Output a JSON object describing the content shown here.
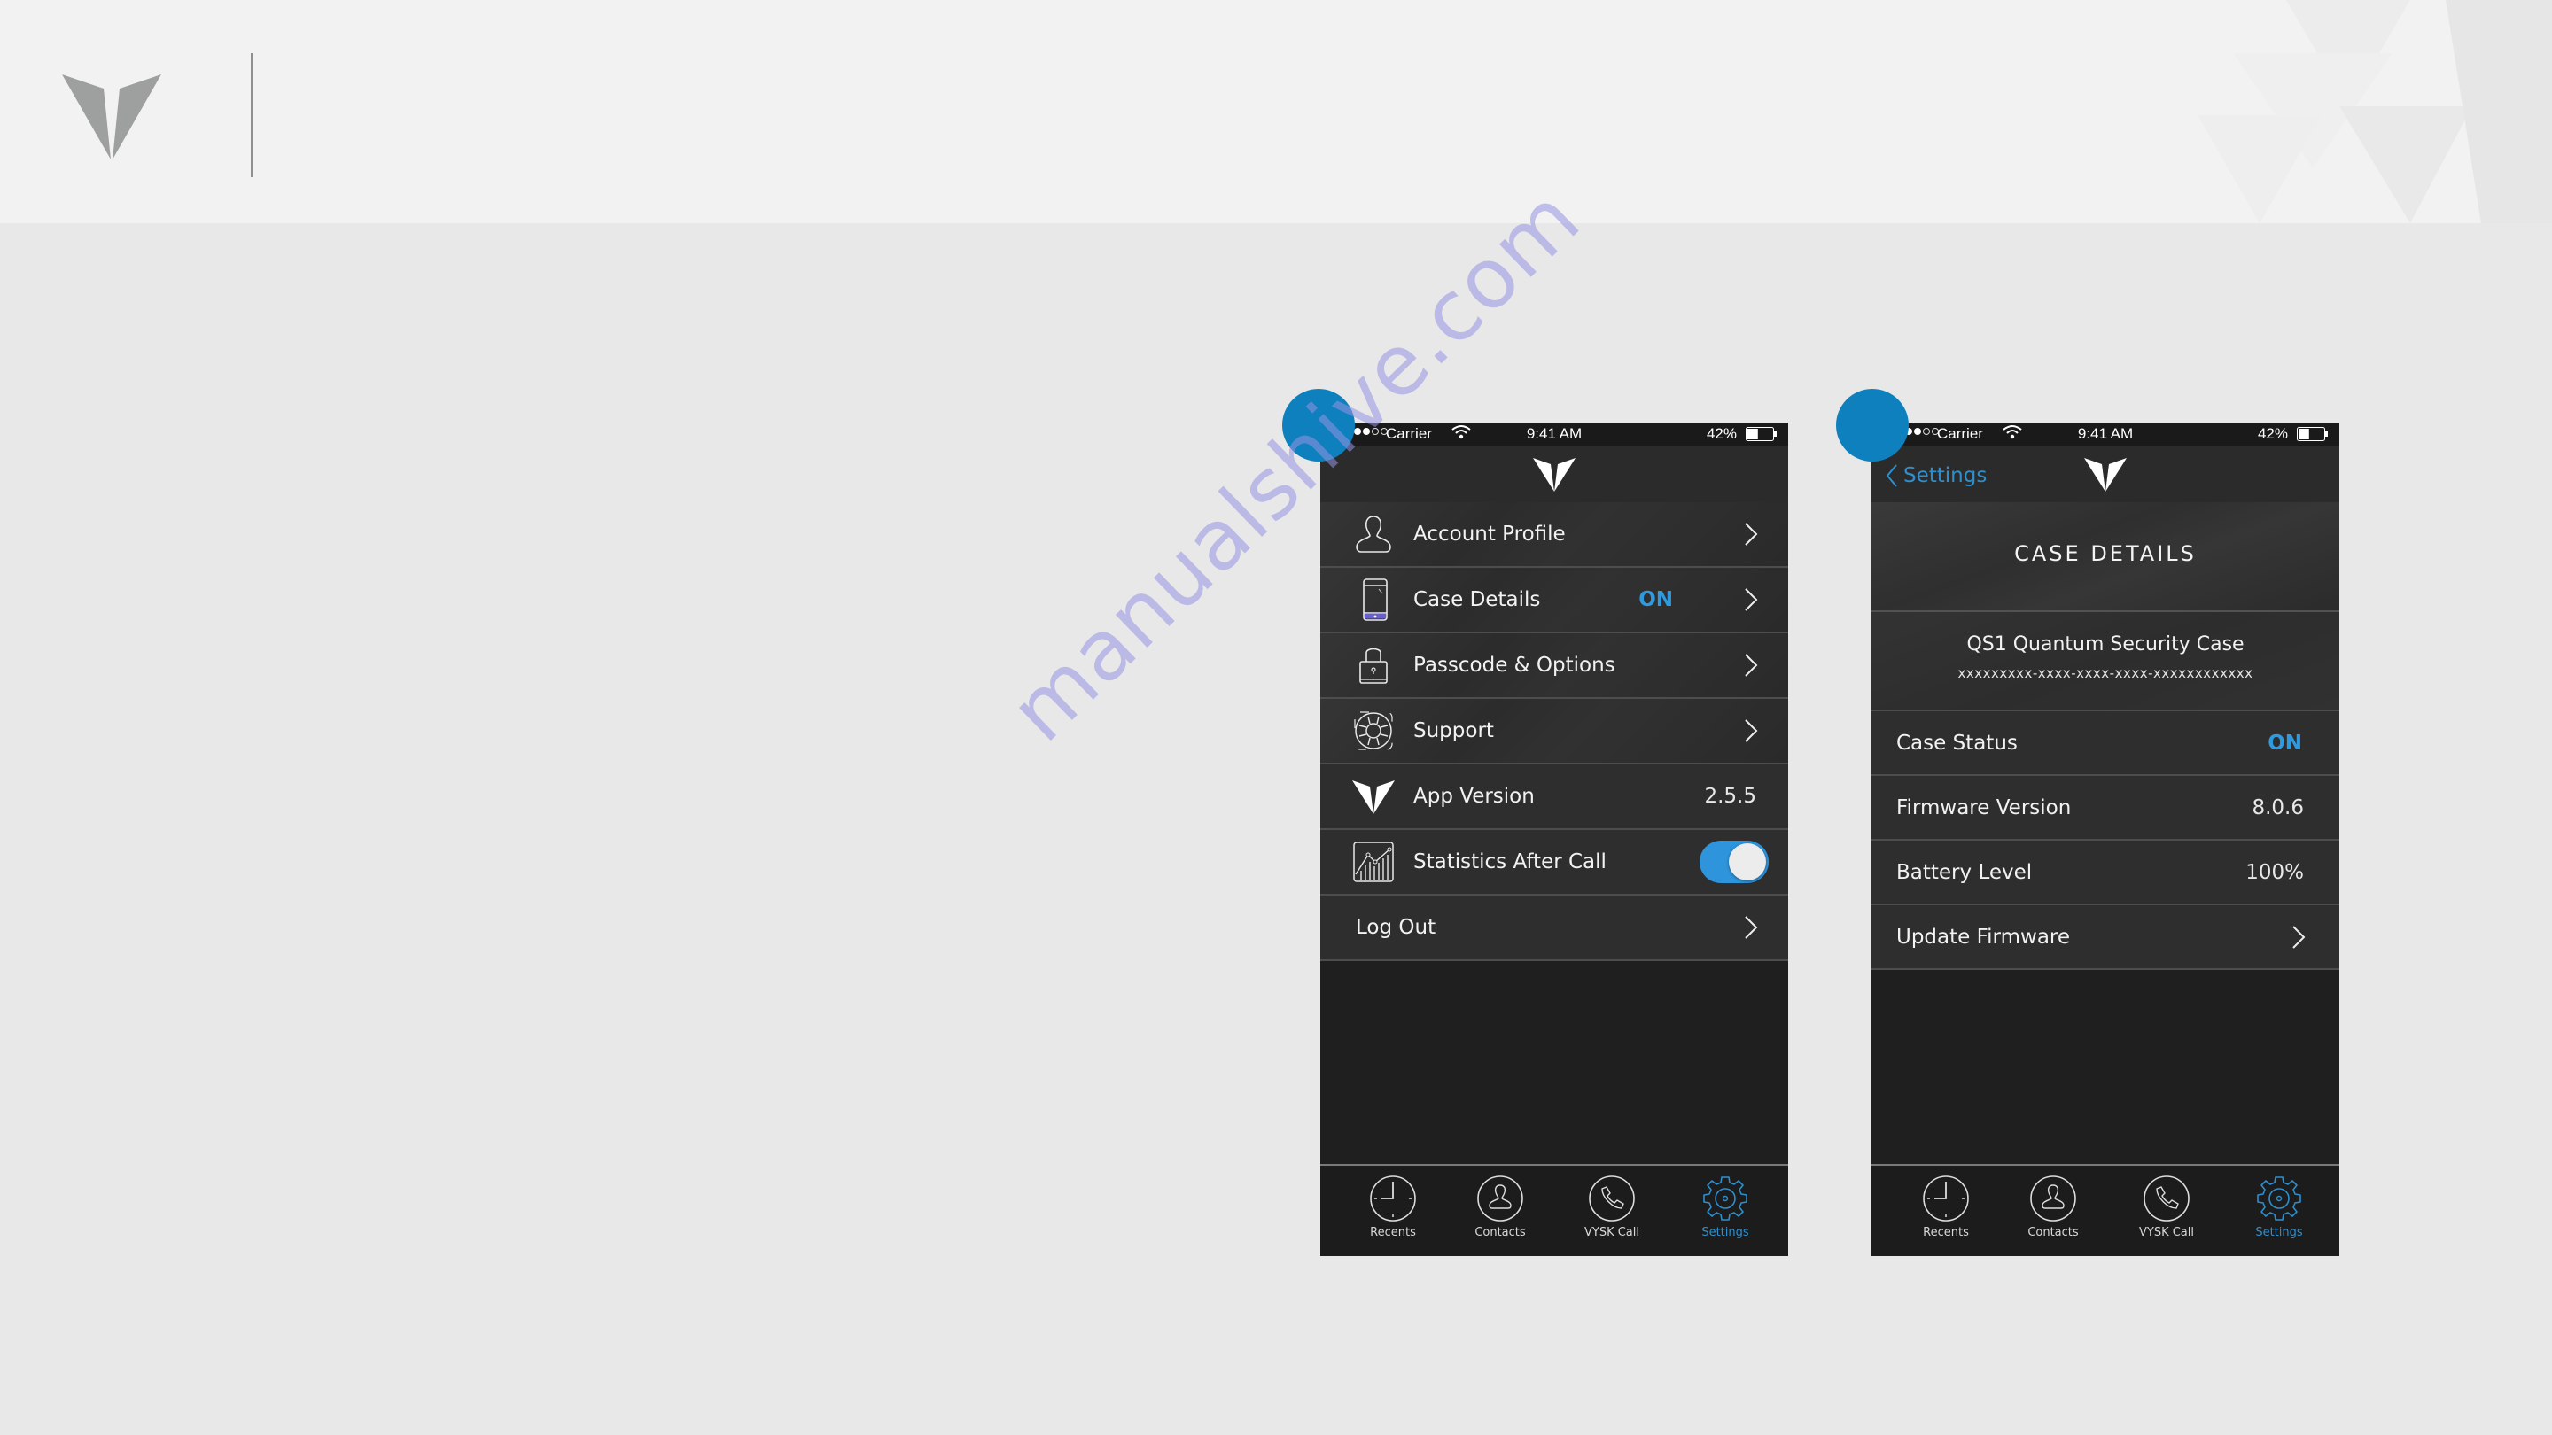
{
  "watermark": "manualshive.com",
  "brand": {
    "logo_icon": "vysk-v-logo"
  },
  "phones": [
    {
      "status_bar": {
        "carrier": "Carrier",
        "time": "9:41 AM",
        "battery_percent": "42%",
        "battery_level": 0.42
      },
      "nav": {
        "logo_icon": "vysk-v-logo"
      },
      "rows": [
        {
          "icon": "person-icon",
          "label": "Account Profile",
          "value": "",
          "accessory": "chevron"
        },
        {
          "icon": "phone-icon",
          "label": "Case Details",
          "value": "ON",
          "accessory": "chevron"
        },
        {
          "icon": "lock-icon",
          "label": "Passcode & Options",
          "value": "",
          "accessory": "chevron"
        },
        {
          "icon": "lifebuoy-icon",
          "label": "Support",
          "value": "",
          "accessory": "chevron"
        },
        {
          "icon": "vysk-v-logo",
          "label": "App Version",
          "value": "2.5.5",
          "accessory": "none"
        },
        {
          "icon": "chart-icon",
          "label": "Statistics After Call",
          "value": "",
          "accessory": "toggle",
          "toggle_on": true
        },
        {
          "icon": "",
          "label": "Log Out",
          "value": "",
          "accessory": "chevron"
        }
      ],
      "tabs": [
        {
          "icon": "clock-icon",
          "label": "Recents",
          "active": false
        },
        {
          "icon": "contact-icon",
          "label": "Contacts",
          "active": false
        },
        {
          "icon": "phone-call-icon",
          "label": "VYSK Call",
          "active": false
        },
        {
          "icon": "gear-icon",
          "label": "Settings",
          "active": true
        }
      ]
    },
    {
      "status_bar": {
        "carrier": "Carrier",
        "time": "9:41 AM",
        "battery_percent": "42%",
        "battery_level": 0.42
      },
      "nav": {
        "back_label": "Settings",
        "logo_icon": "vysk-v-logo"
      },
      "title": "CASE DETAILS",
      "case": {
        "name": "QS1 Quantum Security Case",
        "serial": "xxxxxxxxx-xxxx-xxxx-xxxx-xxxxxxxxxxxx"
      },
      "rows": [
        {
          "label": "Case Status",
          "value": "ON",
          "accessory": "none"
        },
        {
          "label": "Firmware Version",
          "value": "8.0.6",
          "accessory": "none"
        },
        {
          "label": "Battery Level",
          "value": "100%",
          "accessory": "none"
        },
        {
          "label": "Update Firmware",
          "value": "",
          "accessory": "chevron"
        }
      ],
      "tabs": [
        {
          "icon": "clock-icon",
          "label": "Recents",
          "active": false
        },
        {
          "icon": "contact-icon",
          "label": "Contacts",
          "active": false
        },
        {
          "icon": "phone-call-icon",
          "label": "VYSK Call",
          "active": false
        },
        {
          "icon": "gear-icon",
          "label": "Settings",
          "active": true
        }
      ]
    }
  ],
  "colors": {
    "accent": "#2e8fce",
    "marker": "#0e80bd",
    "on_text": "#2e9be0",
    "toggle": "#2e94dc"
  }
}
